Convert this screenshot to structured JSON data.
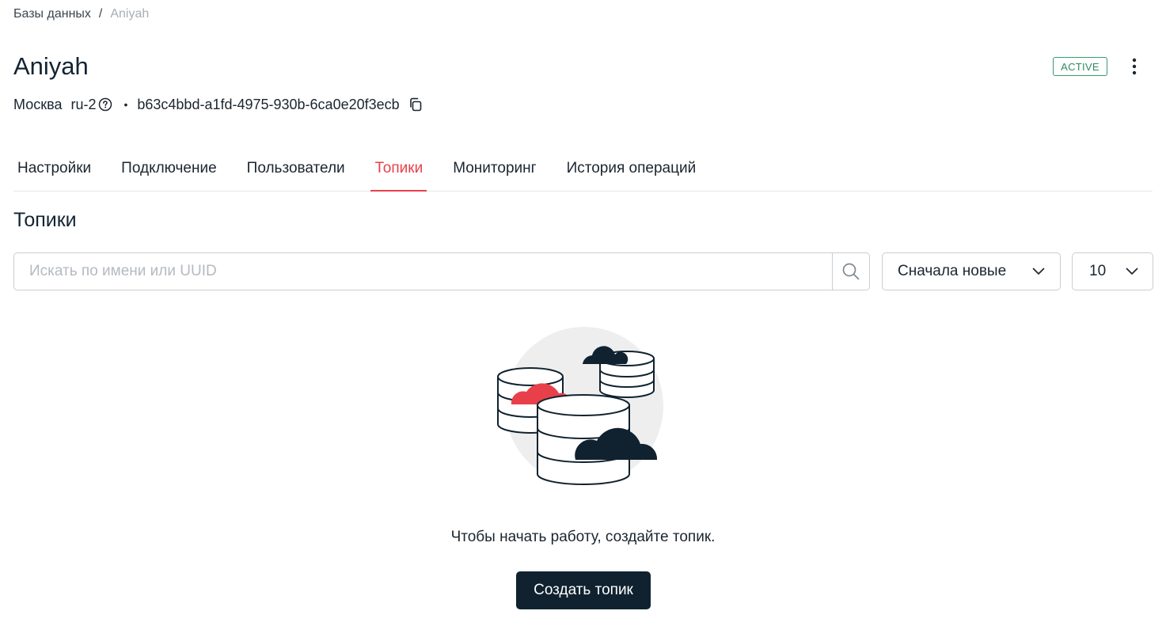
{
  "breadcrumb": {
    "parent": "Базы данных",
    "separator": "/",
    "current": "Aniyah"
  },
  "header": {
    "title": "Aniyah",
    "city": "Москва",
    "region": "ru-2",
    "bullet": "•",
    "uuid": "b63c4bbd-a1fd-4975-930b-6ca0e20f3ecb",
    "status": "ACTIVE",
    "status_color": "#2f8a60"
  },
  "tabs": [
    {
      "label": "Настройки",
      "active": false
    },
    {
      "label": "Подключение",
      "active": false
    },
    {
      "label": "Пользователи",
      "active": false
    },
    {
      "label": "Топики",
      "active": true
    },
    {
      "label": "Мониторинг",
      "active": false
    },
    {
      "label": "История операций",
      "active": false
    }
  ],
  "section": {
    "title": "Топики"
  },
  "search": {
    "placeholder": "Искать по имени или UUID",
    "value": ""
  },
  "sort": {
    "selected": "Сначала новые"
  },
  "page_size": {
    "selected": "10"
  },
  "empty_state": {
    "message": "Чтобы начать работу, создайте топик.",
    "button_label": "Создать топик"
  },
  "colors": {
    "accent": "#e8404a",
    "primary_dark": "#10222f",
    "success": "#2f8a60"
  }
}
